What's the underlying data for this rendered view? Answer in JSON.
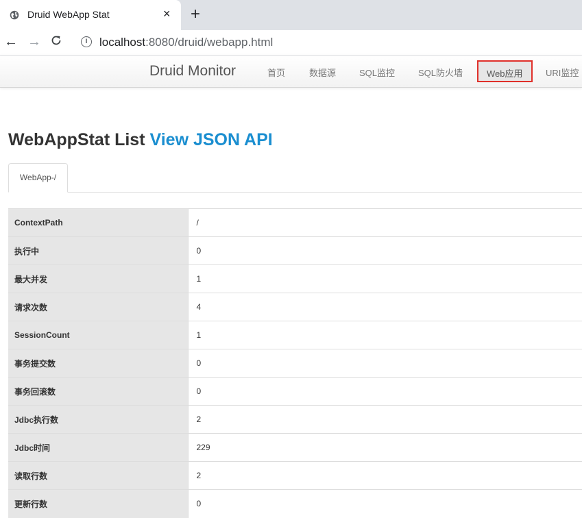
{
  "browser": {
    "tab_title": "Druid WebApp Stat",
    "tab_close": "×",
    "new_tab": "+",
    "url_host": "localhost",
    "url_rest": ":8080/druid/webapp.html",
    "back": "←",
    "forward": "→",
    "info": "i"
  },
  "navbar": {
    "brand": "Druid Monitor",
    "items": [
      "首页",
      "数据源",
      "SQL监控",
      "SQL防火墙",
      "Web应用",
      "URI监控"
    ],
    "active_index": 4,
    "highlight_color": "#e0302a"
  },
  "heading": {
    "title": "WebAppStat List",
    "api_link": "View JSON API",
    "link_color": "#1a8ed0"
  },
  "tabs": [
    "WebApp-/"
  ],
  "stats": [
    {
      "key": "ContextPath",
      "value": "/"
    },
    {
      "key": "执行中",
      "value": "0"
    },
    {
      "key": "最大并发",
      "value": "1"
    },
    {
      "key": "请求次数",
      "value": "4"
    },
    {
      "key": "SessionCount",
      "value": "1"
    },
    {
      "key": "事务提交数",
      "value": "0"
    },
    {
      "key": "事务回滚数",
      "value": "0"
    },
    {
      "key": "Jdbc执行数",
      "value": "2"
    },
    {
      "key": "Jdbc时间",
      "value": "229"
    },
    {
      "key": "读取行数",
      "value": "2"
    },
    {
      "key": "更新行数",
      "value": "0"
    }
  ]
}
